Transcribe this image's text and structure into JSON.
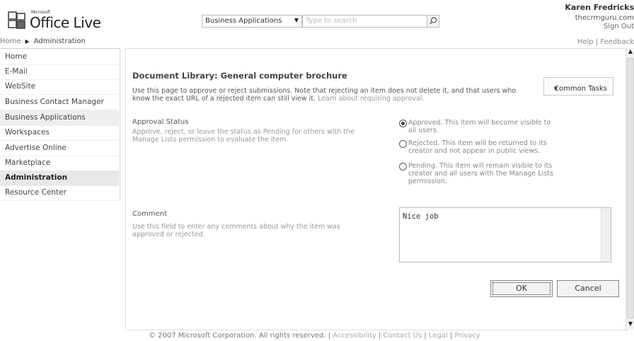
{
  "header": {
    "logo_small": "Microsoft",
    "logo_text": "Office Live",
    "breadcrumb": [
      "Home",
      "Administration"
    ],
    "search_scope": "Business Applications",
    "search_placeholder": "Type to search",
    "user_name": "Karen Fredricks",
    "user_site": "thecrmguru.com",
    "sign_out": "Sign Out",
    "help": "Help",
    "feedback": "Feedback",
    "divider": "|"
  },
  "nav": {
    "items": [
      {
        "label": "Home"
      },
      {
        "label": "E-Mail"
      },
      {
        "label": "WebSite"
      },
      {
        "label": "Business Contact Manager"
      },
      {
        "label": "Business Applications"
      },
      {
        "label": "Workspaces"
      },
      {
        "label": "Advertise Online"
      },
      {
        "label": "Marketplace"
      },
      {
        "label": "Administration"
      },
      {
        "label": "Resource Center"
      }
    ]
  },
  "main": {
    "title": "Document Library: General computer brochure",
    "intro": "Use this page to approve or reject submissions. Note that rejecting an item does not delete it, and that users who know the exact URL of a rejected item can still view it.",
    "intro_link": "Learn about requiring approval.",
    "common_tasks": "Common Tasks",
    "approval_title": "Approval Status",
    "approval_desc": "Approve, reject, or leave the status as Pending for others with the Manage Lists permission to evaluate the item.",
    "options": [
      {
        "label": "Approved. This item will become visible to all users.",
        "selected": true
      },
      {
        "label": "Rejected. This item will be returned to its creator and not appear in public views.",
        "selected": false
      },
      {
        "label": "Pending. This item will remain visible to its creator and all users with the Manage Lists permission.",
        "selected": false
      }
    ],
    "comment_title": "Comment",
    "comment_desc": "Use this field to enter any comments about why the item was approved or rejected.",
    "comment_value": "Nice job",
    "ok": "OK",
    "cancel": "Cancel"
  },
  "footer": {
    "copyright": "© 2007 Microsoft Corporation. All rights reserved.",
    "links": [
      "Accessibility",
      "Contact Us",
      "Legal",
      "Privacy"
    ],
    "divider": "|"
  },
  "colors": {
    "active_nav": "#e8e8e8",
    "border": "#cccccc"
  }
}
